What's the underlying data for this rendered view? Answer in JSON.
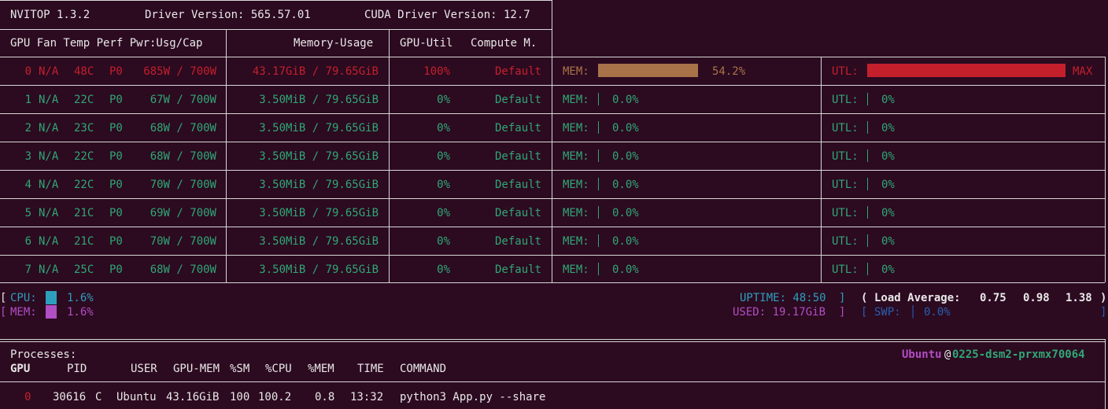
{
  "header": {
    "version": "NVITOP 1.3.2",
    "driver": "Driver Version: 565.57.01",
    "cuda": "CUDA Driver Version: 12.7"
  },
  "columns": {
    "gpu_fan_temp_perf_pwr": "GPU Fan Temp Perf Pwr:Usg/Cap",
    "memory_usage": "Memory-Usage",
    "gpu_util": "GPU-Util",
    "compute_mode": "Compute M."
  },
  "gpus": [
    {
      "id": "0",
      "fan": "N/A",
      "temp": "48C",
      "perf": "P0",
      "pwr": "685W / 700W",
      "mem": "43.17GiB / 79.65GiB",
      "util": "100%",
      "mode": "Default",
      "mem_label": "MEM:",
      "mem_pct": "54.2%",
      "mem_frac": 0.542,
      "utl_label": "UTL:",
      "utl_pct": "MAX",
      "utl_frac": 1.0,
      "active": true
    },
    {
      "id": "1",
      "fan": "N/A",
      "temp": "22C",
      "perf": "P0",
      "pwr": "67W / 700W",
      "mem": "3.50MiB / 79.65GiB",
      "util": "0%",
      "mode": "Default",
      "mem_label": "MEM:",
      "mem_pct": "0.0%",
      "mem_frac": 0,
      "utl_label": "UTL:",
      "utl_pct": "0%",
      "utl_frac": 0,
      "active": false
    },
    {
      "id": "2",
      "fan": "N/A",
      "temp": "23C",
      "perf": "P0",
      "pwr": "68W / 700W",
      "mem": "3.50MiB / 79.65GiB",
      "util": "0%",
      "mode": "Default",
      "mem_label": "MEM:",
      "mem_pct": "0.0%",
      "mem_frac": 0,
      "utl_label": "UTL:",
      "utl_pct": "0%",
      "utl_frac": 0,
      "active": false
    },
    {
      "id": "3",
      "fan": "N/A",
      "temp": "22C",
      "perf": "P0",
      "pwr": "68W / 700W",
      "mem": "3.50MiB / 79.65GiB",
      "util": "0%",
      "mode": "Default",
      "mem_label": "MEM:",
      "mem_pct": "0.0%",
      "mem_frac": 0,
      "utl_label": "UTL:",
      "utl_pct": "0%",
      "utl_frac": 0,
      "active": false
    },
    {
      "id": "4",
      "fan": "N/A",
      "temp": "22C",
      "perf": "P0",
      "pwr": "70W / 700W",
      "mem": "3.50MiB / 79.65GiB",
      "util": "0%",
      "mode": "Default",
      "mem_label": "MEM:",
      "mem_pct": "0.0%",
      "mem_frac": 0,
      "utl_label": "UTL:",
      "utl_pct": "0%",
      "utl_frac": 0,
      "active": false
    },
    {
      "id": "5",
      "fan": "N/A",
      "temp": "21C",
      "perf": "P0",
      "pwr": "69W / 700W",
      "mem": "3.50MiB / 79.65GiB",
      "util": "0%",
      "mode": "Default",
      "mem_label": "MEM:",
      "mem_pct": "0.0%",
      "mem_frac": 0,
      "utl_label": "UTL:",
      "utl_pct": "0%",
      "utl_frac": 0,
      "active": false
    },
    {
      "id": "6",
      "fan": "N/A",
      "temp": "21C",
      "perf": "P0",
      "pwr": "70W / 700W",
      "mem": "3.50MiB / 79.65GiB",
      "util": "0%",
      "mode": "Default",
      "mem_label": "MEM:",
      "mem_pct": "0.0%",
      "mem_frac": 0,
      "utl_label": "UTL:",
      "utl_pct": "0%",
      "utl_frac": 0,
      "active": false
    },
    {
      "id": "7",
      "fan": "N/A",
      "temp": "25C",
      "perf": "P0",
      "pwr": "68W / 700W",
      "mem": "3.50MiB / 79.65GiB",
      "util": "0%",
      "mode": "Default",
      "mem_label": "MEM:",
      "mem_pct": "0.0%",
      "mem_frac": 0,
      "utl_label": "UTL:",
      "utl_pct": "0%",
      "utl_frac": 0,
      "active": false
    }
  ],
  "host": {
    "cpu_label": "CPU:",
    "cpu_pct": "1.6%",
    "cpu_frac": 0.016,
    "mem_label": "MEM:",
    "mem_pct": "1.6%",
    "mem_frac": 0.016,
    "uptime": "UPTIME: 48:50",
    "used": "USED: 19.17GiB",
    "load_label": "Load Average:",
    "load": [
      "0.75",
      "0.98",
      "1.38"
    ],
    "swp_label": "SWP:",
    "swp_pct": "0.0%"
  },
  "processes": {
    "title": "Processes:",
    "user": "Ubuntu",
    "at": "@",
    "host": "0225-dsm2-prxmx70064",
    "headers": {
      "gpu": "GPU",
      "pid": "PID",
      "user": "USER",
      "gpu_mem": "GPU-MEM",
      "sm": "%SM",
      "cpu": "%CPU",
      "mem": "%MEM",
      "time": "TIME",
      "command": "COMMAND"
    },
    "rows": [
      {
        "gpu": "0",
        "pid": "30616",
        "type": "C",
        "user": "Ubuntu",
        "gpu_mem": "43.16GiB",
        "sm": "100",
        "cpu": "100.2",
        "mem": "0.8",
        "time": "13:32",
        "command": "python3 App.py --share"
      }
    ]
  },
  "colors": {
    "background": "#2c0a20",
    "green": "#2fa775",
    "red": "#c4202c",
    "mem_bar": "#a9734a",
    "cpu_bar": "#2d9fbd",
    "host_mem_bar": "#b24ec4"
  }
}
